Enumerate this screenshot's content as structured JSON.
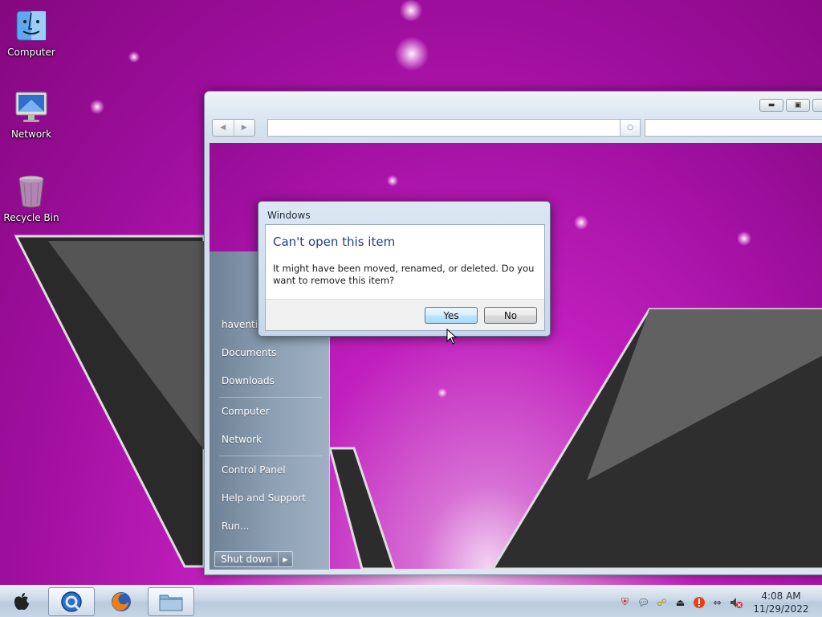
{
  "desktop": {
    "icons": [
      {
        "label": "Computer",
        "icon": "finder-icon"
      },
      {
        "label": "Network",
        "icon": "monitor-icon"
      },
      {
        "label": "Recycle Bin",
        "icon": "recycle-bin-icon"
      }
    ]
  },
  "explorer": {
    "window_buttons": [
      "minimize",
      "maximize",
      "close"
    ]
  },
  "start_menu": {
    "user": "haventis",
    "items": [
      "Documents",
      "Downloads",
      "Computer",
      "Network",
      "Control Panel",
      "Help and Support",
      "Run..."
    ],
    "shutdown_label": "Shut down"
  },
  "dialog": {
    "title": "Windows",
    "heading": "Can't open this item",
    "message": "It might have been moved, renamed, or deleted. Do you want to remove this item?",
    "yes_label": "Yes",
    "no_label": "No"
  },
  "taskbar": {
    "start_icon": "apple-icon",
    "buttons": [
      {
        "icon": "quicktime-icon",
        "active": true
      },
      {
        "icon": "firefox-icon",
        "active": false
      },
      {
        "icon": "folder-icon",
        "active": true
      }
    ],
    "tray_icons": [
      "security-shield-icon",
      "speech-bubble-icon",
      "network-tray-icon",
      "eject-icon",
      "alert-icon",
      "connection-icon",
      "volume-muted-icon"
    ],
    "time": "4:08 AM",
    "date": "11/29/2022"
  },
  "colors": {
    "desktop_bg": "#c01fbd",
    "dialog_heading": "#1e3f8a",
    "taskbar": "#c9d7e6"
  }
}
